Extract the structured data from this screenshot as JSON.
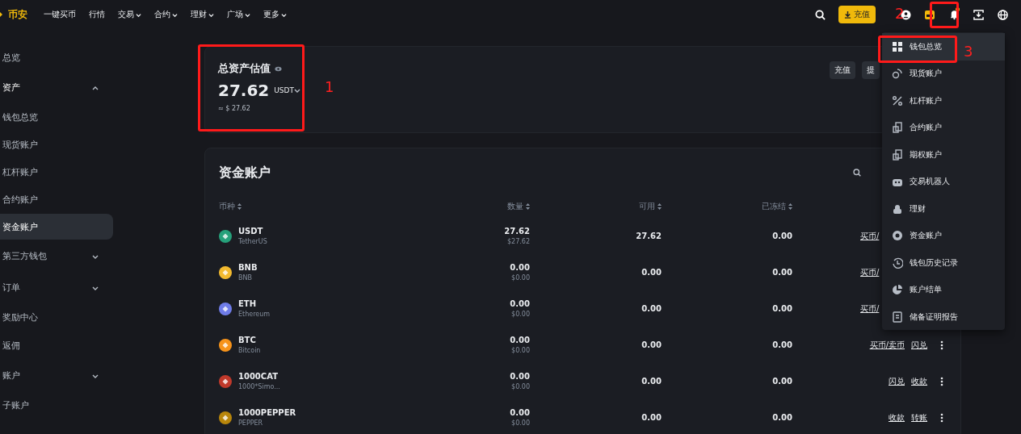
{
  "topbar": {
    "logo": "币安",
    "nav": [
      {
        "label": "一键买币",
        "caret": false
      },
      {
        "label": "行情",
        "caret": false
      },
      {
        "label": "交易",
        "caret": true
      },
      {
        "label": "合约",
        "caret": true
      },
      {
        "label": "理财",
        "caret": true
      },
      {
        "label": "广场",
        "caret": true
      },
      {
        "label": "更多",
        "caret": true
      }
    ],
    "deposit_button": "充值",
    "notification_dot": true
  },
  "sidebar": {
    "items": [
      {
        "label": "总览",
        "kind": "link",
        "selected": false
      },
      {
        "label": "资产",
        "kind": "group",
        "expanded": true,
        "children": [
          {
            "label": "钱包总览",
            "selected": false
          },
          {
            "label": "现货账户",
            "selected": false
          },
          {
            "label": "杠杆账户",
            "selected": false
          },
          {
            "label": "合约账户",
            "selected": false
          },
          {
            "label": "资金账户",
            "selected": true
          }
        ]
      },
      {
        "label": "第三方钱包",
        "kind": "group",
        "expanded": false
      },
      {
        "label": "订单",
        "kind": "group",
        "expanded": false
      },
      {
        "label": "奖励中心",
        "kind": "link",
        "selected": false
      },
      {
        "label": "返佣",
        "kind": "link",
        "selected": false
      },
      {
        "label": "账户",
        "kind": "group",
        "expanded": false
      },
      {
        "label": "子账户",
        "kind": "link",
        "selected": false
      }
    ]
  },
  "overview": {
    "title": "总资产估值",
    "amount": "27.62",
    "currency": "USDT",
    "usd": "≈ $ 27.62",
    "buttons": [
      "充值",
      "提"
    ]
  },
  "funds": {
    "title": "资金账户",
    "columns": [
      "币种",
      "数量",
      "可用",
      "已冻结"
    ],
    "rows": [
      {
        "symbol": "USDT",
        "name": "TetherUS",
        "color": "#26a17b",
        "amount": "27.62",
        "amount_usd": "$27.62",
        "available": "27.62",
        "frozen": "0.00",
        "actions": [
          "买币/"
        ],
        "more_menu": false
      },
      {
        "symbol": "BNB",
        "name": "BNB",
        "color": "#f3ba2f",
        "amount": "0.00",
        "amount_usd": "$0.00",
        "available": "0.00",
        "frozen": "0.00",
        "actions": [
          "买币/"
        ],
        "more_menu": false
      },
      {
        "symbol": "ETH",
        "name": "Ethereum",
        "color": "#6f7ce8",
        "amount": "0.00",
        "amount_usd": "$0.00",
        "available": "0.00",
        "frozen": "0.00",
        "actions": [
          "买币/"
        ],
        "more_menu": false
      },
      {
        "symbol": "BTC",
        "name": "Bitcoin",
        "color": "#f7931a",
        "amount": "0.00",
        "amount_usd": "$0.00",
        "available": "0.00",
        "frozen": "0.00",
        "actions": [
          "买币/卖币",
          "闪兑"
        ],
        "more_menu": true
      },
      {
        "symbol": "1000CAT",
        "name": "1000*Simo...",
        "color": "#c0392b",
        "amount": "0.00",
        "amount_usd": "$0.00",
        "available": "0.00",
        "frozen": "0.00",
        "actions": [
          "闪兑",
          "收款"
        ],
        "more_menu": true
      },
      {
        "symbol": "1000PEPPER",
        "name": "PEPPER",
        "color": "#b8860b",
        "amount": "0.00",
        "amount_usd": "$0.00",
        "available": "0.00",
        "frozen": "0.00",
        "actions": [
          "收款",
          "转账"
        ],
        "more_menu": true
      }
    ]
  },
  "wallet_menu": {
    "items": [
      {
        "label": "钱包总览",
        "kind": "grid",
        "selected": true
      },
      {
        "label": "现货账户",
        "kind": "spot",
        "selected": false
      },
      {
        "label": "杠杆账户",
        "kind": "percent",
        "selected": false
      },
      {
        "label": "合约账户",
        "kind": "doc",
        "selected": false
      },
      {
        "label": "期权账户",
        "kind": "doc",
        "selected": false
      },
      {
        "label": "交易机器人",
        "kind": "robot",
        "selected": false
      },
      {
        "label": "理财",
        "kind": "bag",
        "selected": false
      },
      {
        "label": "资金账户",
        "kind": "ring",
        "selected": false
      },
      {
        "label": "钱包历史记录",
        "kind": "history",
        "selected": false
      },
      {
        "label": "账户结单",
        "kind": "pie",
        "selected": false
      },
      {
        "label": "储备证明报告",
        "kind": "file",
        "selected": false
      }
    ]
  },
  "annotations": [
    "1",
    "2",
    "3"
  ]
}
